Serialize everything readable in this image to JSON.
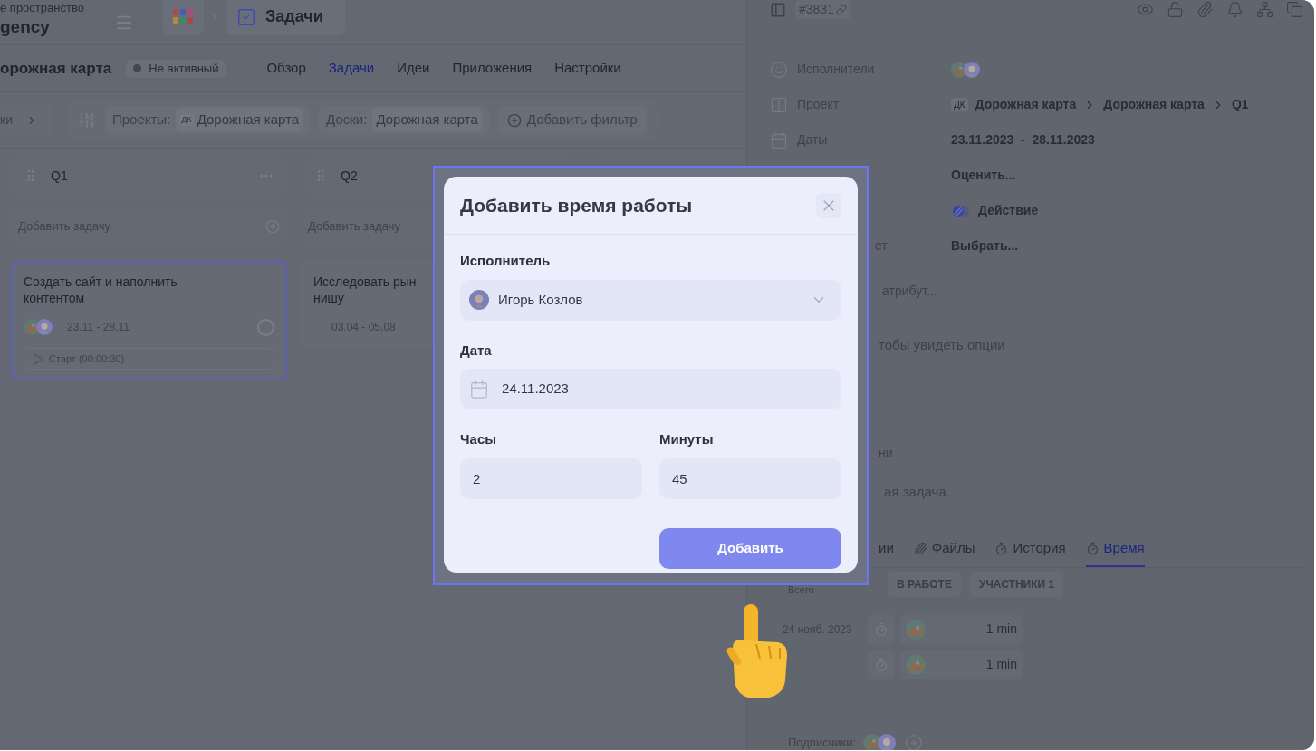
{
  "workspace": {
    "caption": "е пространство",
    "name": "gency"
  },
  "breadcrumb": {
    "current": "Задачи"
  },
  "project": {
    "title": "орожная карта",
    "status": "Не активный",
    "active": false
  },
  "nav_tabs": [
    {
      "label": "Обзор",
      "selected": false
    },
    {
      "label": "Задачи",
      "selected": true
    },
    {
      "label": "Идеи",
      "selected": false
    },
    {
      "label": "Приложения",
      "selected": false
    },
    {
      "label": "Настройки",
      "selected": false
    }
  ],
  "filters": {
    "views": "ки",
    "items": [
      {
        "label": "Проекты:",
        "badge": "ДК",
        "value": "Дорожная карта"
      },
      {
        "label": "Доски:",
        "value": "Дорожная карта"
      }
    ],
    "add": "Добавить фильтр"
  },
  "columns": [
    {
      "title": "Q1",
      "add_placeholder": "Добавить задачу",
      "cards": [
        {
          "title_lines": [
            "Создать сайт и наполнить",
            "контентом"
          ],
          "selected": true,
          "done": false,
          "avatars": [
            {
              "kind": "illustration"
            },
            {
              "kind": "portrait"
            }
          ],
          "dates": "23.11  -  28.11",
          "timer": "Старт (00:00:30)"
        }
      ]
    },
    {
      "title": "Q2",
      "add_placeholder": "Добавить задачу",
      "cards": [
        {
          "title_lines": [
            "Исследовать рын",
            "нишу"
          ],
          "selected": false,
          "dates": "03.04  -  05.08"
        }
      ]
    }
  ],
  "task_panel": {
    "number": "#3831",
    "properties": [
      {
        "kind": "assignees",
        "label": "Исполнители",
        "avatars": [
          {
            "kind": "illustration"
          },
          {
            "kind": "portrait"
          }
        ]
      },
      {
        "kind": "path",
        "label": "Проект",
        "badge": "ДК",
        "path": [
          "Дорожная карта",
          "Дорожная карта",
          "Q1"
        ]
      },
      {
        "kind": "dates",
        "label": "Даты",
        "value": "23.11.2023  -  28.11.2023"
      },
      {
        "kind": "text",
        "value": "Оценить..."
      },
      {
        "kind": "type",
        "value": "Действие"
      },
      {
        "kind": "text",
        "label_fragment": "ет",
        "value": "Выбрать..."
      }
    ],
    "add_attribute": "атрибут...",
    "hint": "тобы увидеть опции",
    "section_fragment": "ни",
    "subtask_placeholder": "ая задача...",
    "tabs": [
      {
        "label": "ии",
        "kind": "plain",
        "selected": false
      },
      {
        "label": "Файлы",
        "kind": "files",
        "selected": false
      },
      {
        "label": "История",
        "kind": "history",
        "selected": false
      },
      {
        "label": "Время",
        "kind": "time",
        "selected": true
      }
    ],
    "total_label": "Всего",
    "summary_chips": [
      "В РАБОТЕ",
      "УЧАСТНИКИ 1"
    ],
    "time_entries": [
      {
        "date": "24 нояб. 2023",
        "duration": "1 min"
      },
      {
        "duration": "1 min"
      }
    ],
    "subscribers": {
      "label": "Подписчики:",
      "avatars": [
        {
          "kind": "illustration"
        },
        {
          "kind": "portrait"
        }
      ]
    }
  },
  "dialog": {
    "title": "Добавить время работы",
    "assignee": {
      "label": "Исполнитель",
      "value": "Игорь Козлов"
    },
    "date": {
      "label": "Дата",
      "value": "24.11.2023"
    },
    "hours": {
      "label": "Часы",
      "value": "2"
    },
    "minutes": {
      "label": "Минуты",
      "value": "45"
    },
    "submit": "Добавить"
  }
}
